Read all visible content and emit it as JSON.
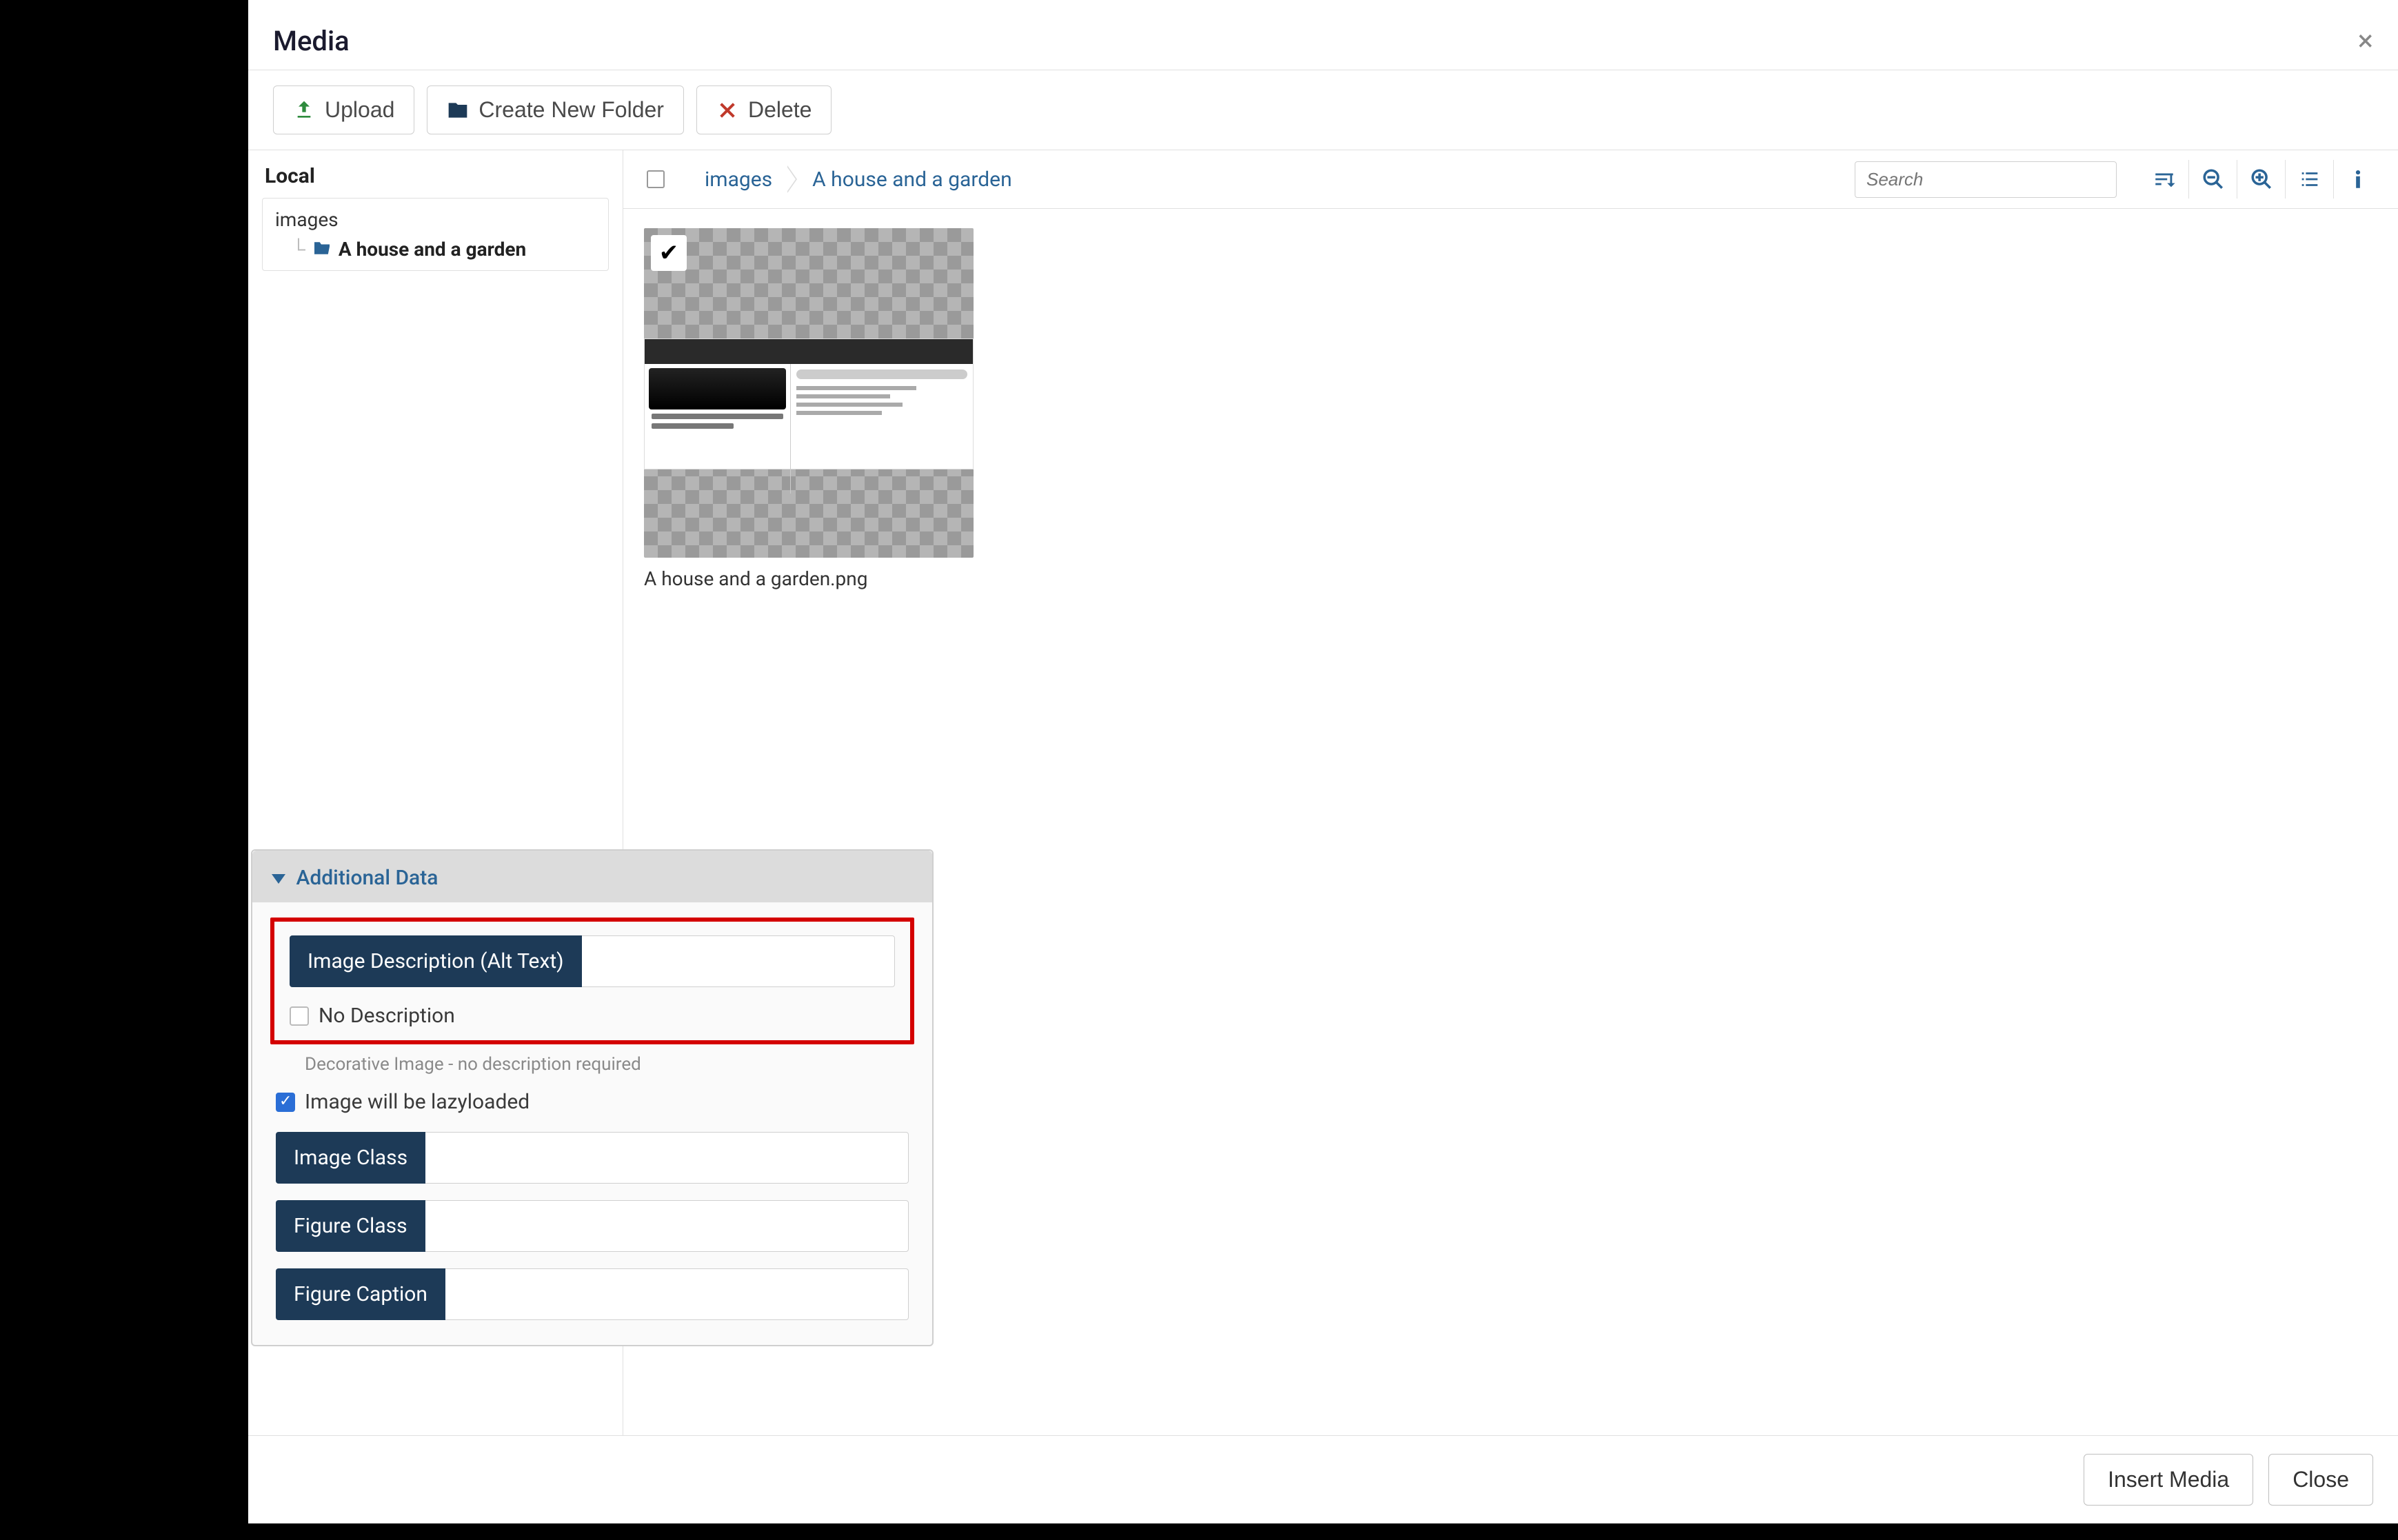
{
  "header": {
    "title": "Media"
  },
  "toolbar": {
    "upload": "Upload",
    "new_folder": "Create New Folder",
    "delete": "Delete"
  },
  "sidebar": {
    "title": "Local",
    "root": "images",
    "child": "A house and a garden"
  },
  "content_top": {
    "crumb1": "images",
    "crumb2": "A house and a garden",
    "search_placeholder": "Search"
  },
  "thumbnail": {
    "caption": "A house and a garden.png"
  },
  "panel": {
    "header": "Additional Data",
    "alt_label": "Image Description (Alt Text)",
    "alt_value": "",
    "no_desc_label": "No Description",
    "no_desc_checked": false,
    "no_desc_hint": "Decorative Image - no description required",
    "lazy_label": "Image will be lazyloaded",
    "lazy_checked": true,
    "img_class_label": "Image Class",
    "img_class_value": "",
    "fig_class_label": "Figure Class",
    "fig_class_value": "",
    "fig_caption_label": "Figure Caption",
    "fig_caption_value": ""
  },
  "footer": {
    "insert": "Insert Media",
    "close": "Close"
  },
  "colors": {
    "accent": "#2a6496",
    "dark_label_bg": "#1d3a57",
    "highlight": "#d40000"
  }
}
